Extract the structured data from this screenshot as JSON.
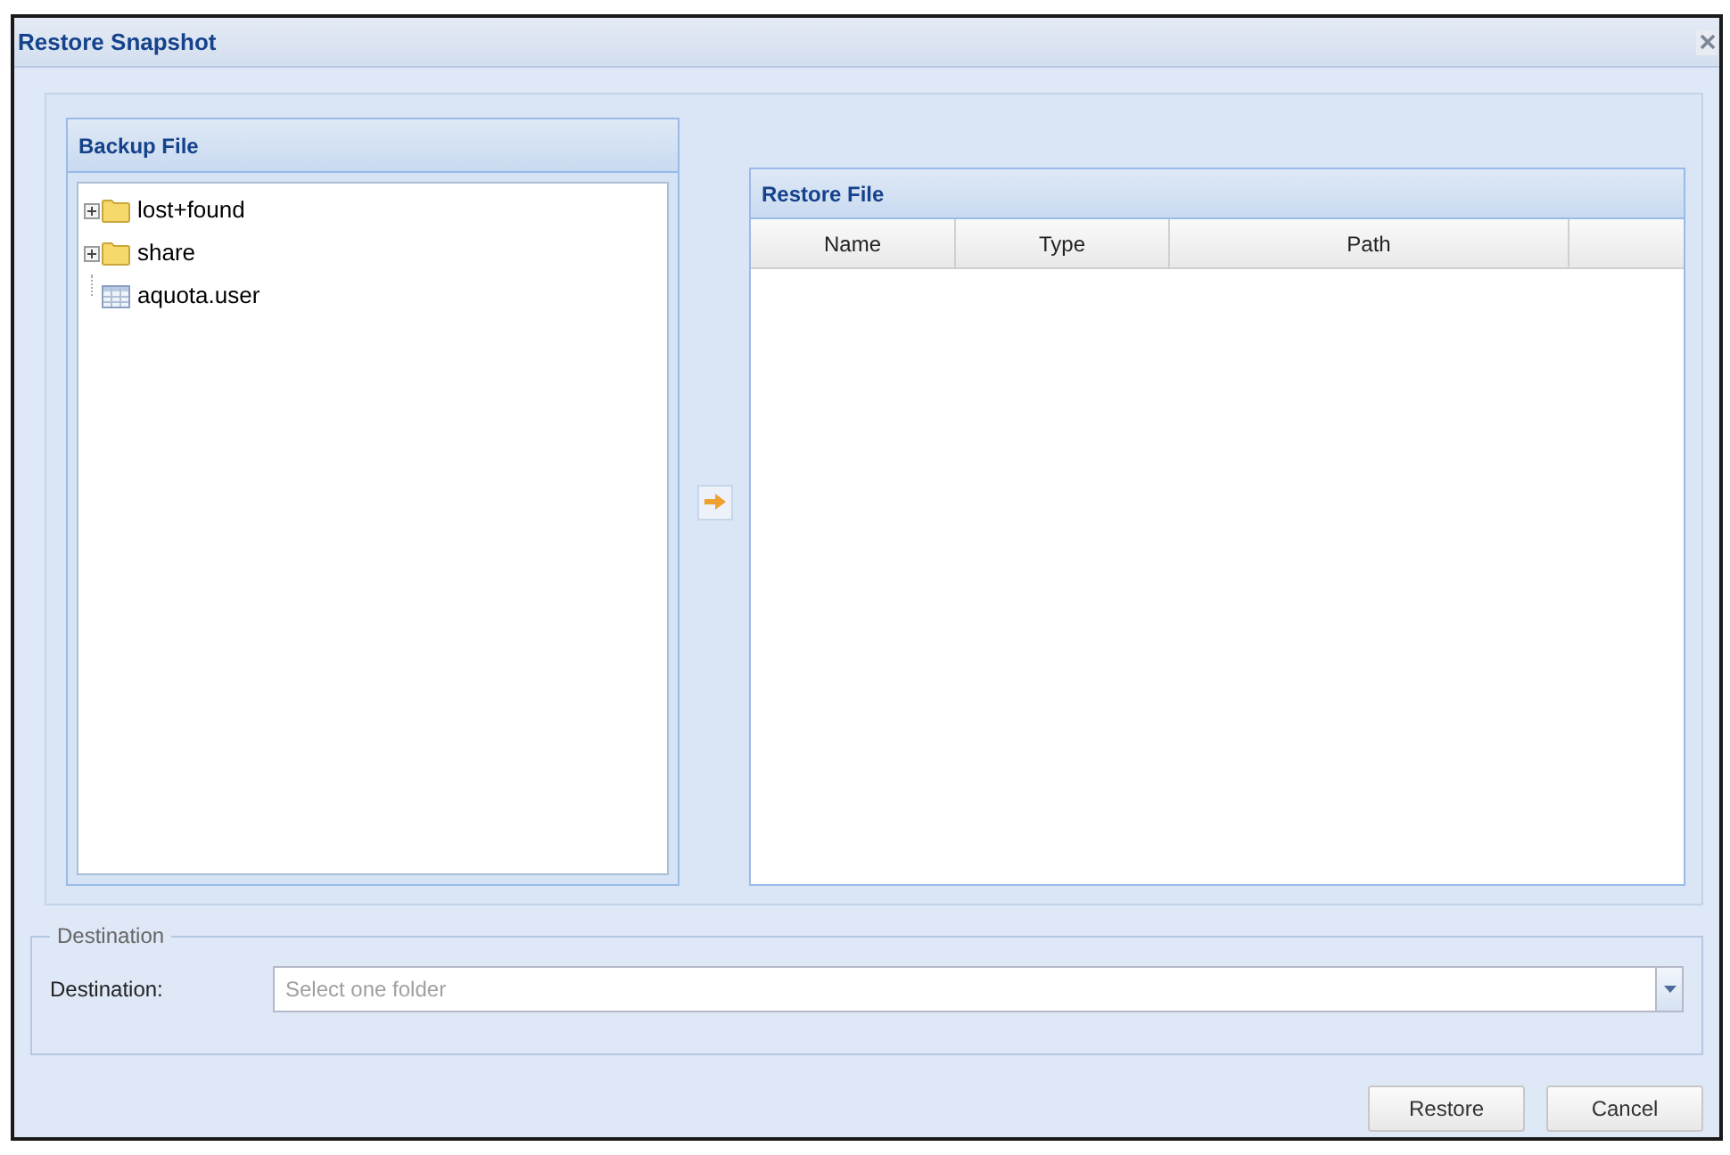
{
  "window": {
    "title": "Restore Snapshot"
  },
  "backup_panel": {
    "title": "Backup File",
    "tree": [
      {
        "label": "lost+found",
        "kind": "folder",
        "expanded": false
      },
      {
        "label": "share",
        "kind": "folder",
        "expanded": false
      },
      {
        "label": "aquota.user",
        "kind": "file"
      }
    ]
  },
  "restore_panel": {
    "title": "Restore File",
    "columns": [
      "Name",
      "Type",
      "Path"
    ]
  },
  "destination": {
    "legend": "Destination",
    "label": "Destination:",
    "placeholder": "Select one folder"
  },
  "buttons": [
    "Restore",
    "Cancel"
  ]
}
